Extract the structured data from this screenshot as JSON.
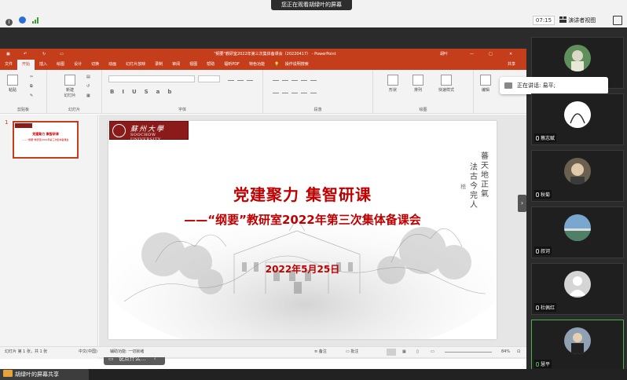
{
  "meeting": {
    "banner": "您正在观看胡绿叶的屏幕",
    "time": "07:15",
    "view_mode": "演讲者视图",
    "share_tag": "胡绿叶的屏幕共享"
  },
  "ppt": {
    "doc_title": "\"纲要\"教研室2022年第三次集体备课会（20220417） - PowerPoint",
    "user": "胡叶",
    "share": "共享",
    "tabs": [
      "文件",
      "开始",
      "插入",
      "绘图",
      "设计",
      "切换",
      "动画",
      "幻灯片放映",
      "录制",
      "审阅",
      "视图",
      "帮助",
      "福昕PDF",
      "特色功能",
      "操作说明搜索"
    ],
    "ribbon": {
      "paste": "粘贴",
      "new_slide": "新建\n幻灯片",
      "shape": "形状",
      "arrange": "排列",
      "quick_style": "快速样式",
      "select": "编辑",
      "groups": [
        "剪贴板",
        "幻灯片",
        "字体",
        "段落",
        "绘图"
      ]
    },
    "slide_number": "1",
    "slide": {
      "logo_cn": "蘇州大學",
      "logo_en": "SOOCHOW UNIVERSITY",
      "title": "党建聚力  集智研课",
      "subtitle": "——“纲要”教研室2022年第三次集体备课会",
      "date": "2022年5月25日",
      "calligraphy": [
        "蕃天地正氣",
        "法古今完人",
        "稽"
      ]
    },
    "thumb_title": "党建聚力 集智研课",
    "thumb_sub": "——“纲要”教研室2022年第三次集体备课会",
    "notes_prompt": "说点什么...",
    "status": {
      "slide_info": "幻灯片 第 1 张，共 1 张",
      "language": "中文(中国)",
      "accessibility": "辅助功能: 一切就绪",
      "notes": "备注",
      "comments": "批注",
      "zoom": "84%"
    }
  },
  "participants": {
    "speaking_label": "正在讲话: 易平;",
    "tiles": [
      {
        "name": ""
      },
      {
        "name": "蔡志赋"
      },
      {
        "name": "秋菊"
      },
      {
        "name": "叔诃"
      },
      {
        "name": "杜佩红"
      },
      {
        "name": "慧平"
      }
    ]
  },
  "colors": {
    "ppt_accent": "#c43e1c",
    "slide_red": "#c00000",
    "panel_bg": "#2b2b2b"
  }
}
